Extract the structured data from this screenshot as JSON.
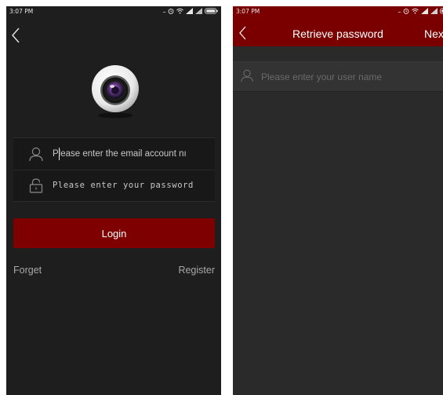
{
  "left_screen": {
    "status_time": "3:07 PM",
    "status_dots": "...",
    "email_placeholder": "Please enter the email account nı",
    "password_placeholder": "Please enter your password",
    "login_label": "Login",
    "forget_label": "Forget",
    "register_label": "Register"
  },
  "right_screen": {
    "status_time": "3:07 PM",
    "status_dots": "...",
    "title": "Retrieve password",
    "next_label": "Next",
    "username_placeholder": "Please enter your user name"
  },
  "colors": {
    "accent_red": "#7f0000",
    "background_dark": "#1e1e1e"
  },
  "icons": [
    "back-arrow-icon",
    "camera-logo-icon",
    "user-icon",
    "lock-icon",
    "alarm-icon",
    "wifi-icon",
    "signal-icon",
    "battery-icon"
  ]
}
